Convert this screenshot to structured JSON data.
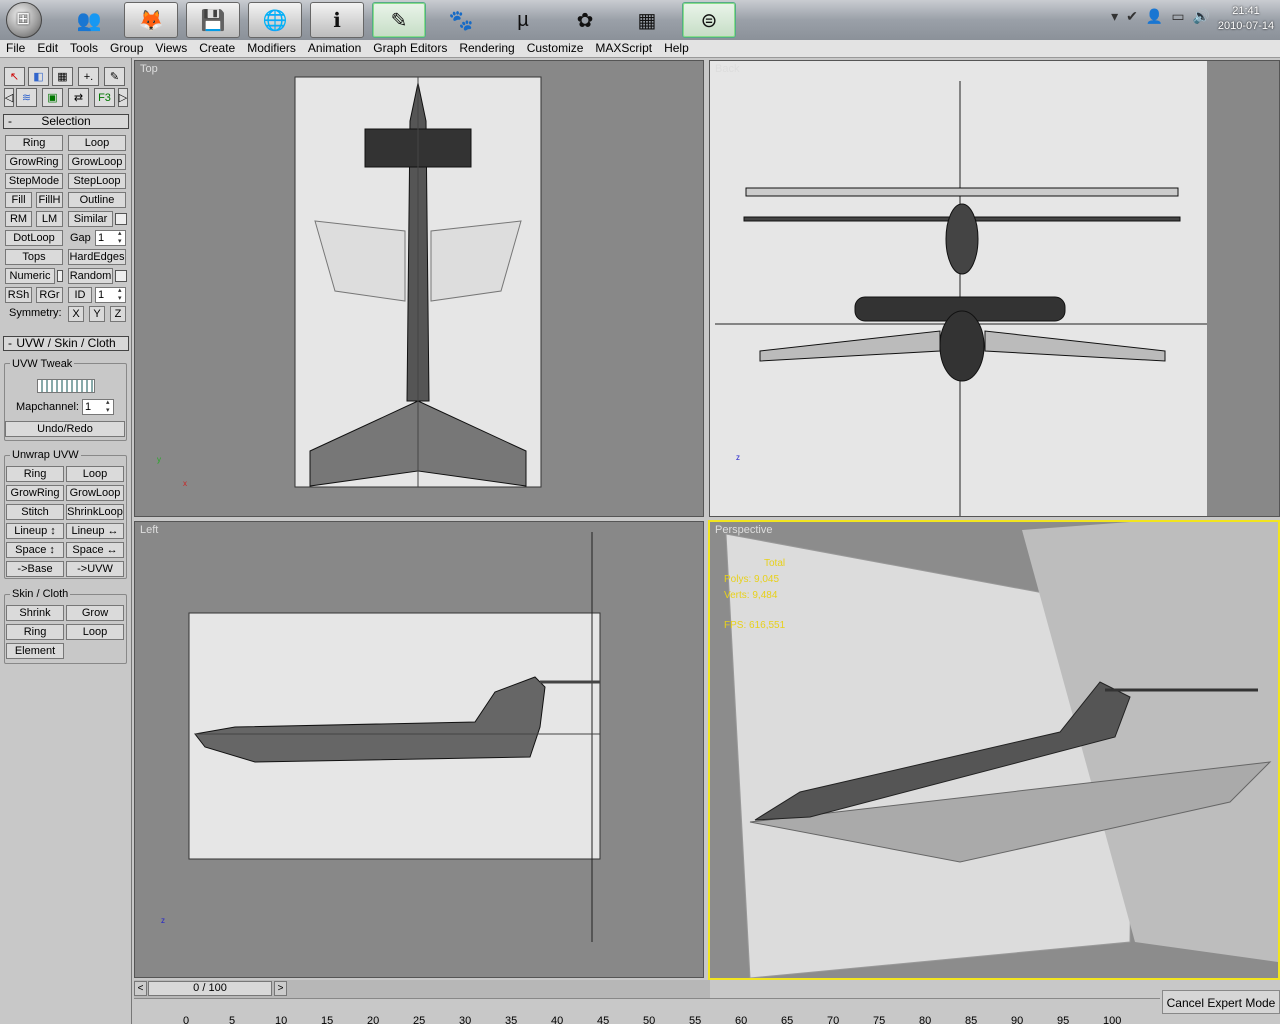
{
  "taskbar": {
    "start_glyph": "⊞",
    "apps": [
      {
        "icon": "people-icon",
        "glyph": "👥"
      },
      {
        "icon": "firefox-icon",
        "glyph": "🦊"
      },
      {
        "icon": "save-icon",
        "glyph": "💾"
      },
      {
        "icon": "ie-icon",
        "glyph": "🌐"
      },
      {
        "icon": "info-icon",
        "glyph": "ℹ"
      },
      {
        "icon": "marker-icon",
        "glyph": "✎"
      },
      {
        "icon": "gimp-icon",
        "glyph": "🐾"
      },
      {
        "icon": "utorrent-icon",
        "glyph": "µ"
      },
      {
        "icon": "leaf-icon",
        "glyph": "✿"
      },
      {
        "icon": "calculator-icon",
        "glyph": "▦"
      },
      {
        "icon": "3dsmax-icon",
        "glyph": "⊜"
      }
    ],
    "tray_glyphs": [
      "▾",
      "✔",
      "👤",
      "▭",
      "🔊"
    ],
    "clock_time": "21:41",
    "clock_date": "2010-07-14"
  },
  "menu": [
    "File",
    "Edit",
    "Tools",
    "Group",
    "Views",
    "Create",
    "Modifiers",
    "Animation",
    "Graph Editors",
    "Rendering",
    "Customize",
    "MAXScript",
    "Help"
  ],
  "selection": {
    "title": "Selection",
    "ring": "Ring",
    "loop": "Loop",
    "growring": "GrowRing",
    "growloop": "GrowLoop",
    "stepmode": "StepMode",
    "steploop": "StepLoop",
    "fill": "Fill",
    "fillh": "FillH",
    "outline": "Outline",
    "rm": "RM",
    "lm": "LM",
    "similar": "Similar",
    "dotloop": "DotLoop",
    "gap_label": "Gap",
    "gap_value": "1",
    "tops": "Tops",
    "hardedges": "HardEdges",
    "numeric": "Numeric",
    "random": "Random",
    "rsh": "RSh",
    "rgr": "RGr",
    "id_label": "ID",
    "id_value": "1",
    "symmetry": "Symmetry:",
    "x": "X",
    "y": "Y",
    "z": "Z"
  },
  "uvw": {
    "title": "UVW / Skin / Cloth",
    "tweak_title": "UVW Tweak",
    "mapchannel_label": "Mapchannel:",
    "mapchannel_value": "1",
    "undoredo": "Undo/Redo",
    "unwrap_title": "Unwrap UVW",
    "ring": "Ring",
    "loop": "Loop",
    "growring": "GrowRing",
    "growloop": "GrowLoop",
    "stitch": "Stitch",
    "shrinkloop": "ShrinkLoop",
    "lineup_v": "Lineup ↕",
    "lineup_h": "Lineup ↔",
    "space_v": "Space ↕",
    "space_h": "Space ↔",
    "tobase": "->Base",
    "touvw": "->UVW",
    "skin_title": "Skin / Cloth",
    "shrink": "Shrink",
    "grow": "Grow",
    "ring2": "Ring",
    "loop2": "Loop",
    "element": "Element"
  },
  "viewports": {
    "top": "Top",
    "back": "Back",
    "left": "Left",
    "perspective": "Perspective"
  },
  "stats": {
    "total": "Total",
    "polys_label": "Polys:",
    "polys": "9,045",
    "verts_label": "Verts:",
    "verts": "9,484",
    "fps_label": "FPS:",
    "fps": "616,551"
  },
  "timeline": {
    "frame": "0 / 100",
    "ticks": [
      "0",
      "5",
      "10",
      "15",
      "20",
      "25",
      "30",
      "35",
      "40",
      "45",
      "50",
      "55",
      "60",
      "65",
      "70",
      "75",
      "80",
      "85",
      "90",
      "95",
      "100"
    ]
  },
  "cancel_expert": "Cancel Expert Mode",
  "colors": {
    "active_viewport": "#f2e51f",
    "stats": "#e8d11a"
  }
}
